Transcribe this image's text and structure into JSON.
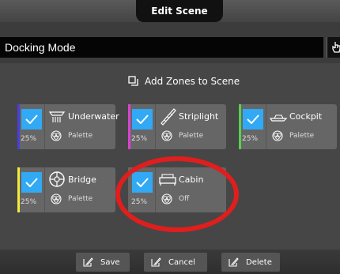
{
  "header": {
    "title": "Edit Scene"
  },
  "scene": {
    "name": "Docking Mode"
  },
  "add_zones": {
    "label": "Add Zones to Scene"
  },
  "zones": [
    {
      "name": "Underwater",
      "brightness": "25%",
      "palette": "Palette",
      "stripe_color": "#4b3fd8",
      "icon": "underwater-light-icon",
      "checked": true
    },
    {
      "name": "Striplight",
      "brightness": "25%",
      "palette": "Palette",
      "stripe_color": "#d844d0",
      "icon": "striplight-icon",
      "checked": true
    },
    {
      "name": "Cockpit",
      "brightness": "25%",
      "palette": "Palette",
      "stripe_color": "#58d14c",
      "icon": "boat-icon",
      "checked": true
    },
    {
      "name": "Bridge",
      "brightness": "25%",
      "palette": "Palette",
      "stripe_color": "#f5ea3a",
      "icon": "steering-wheel-icon",
      "checked": true
    },
    {
      "name": "Cabin",
      "brightness": "25%",
      "palette": "Off",
      "stripe_color": "#666666",
      "icon": "bed-icon",
      "checked": true
    }
  ],
  "footer": {
    "save_label": "Save",
    "cancel_label": "Cancel",
    "delete_label": "Delete"
  },
  "colors": {
    "accent": "#31a9f5",
    "annotation": "#e01e1e"
  }
}
